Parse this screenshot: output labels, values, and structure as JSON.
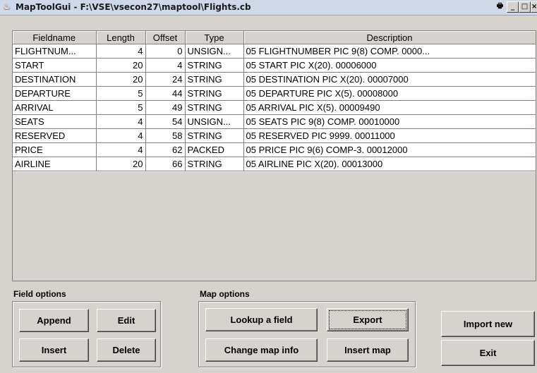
{
  "window": {
    "title": "MapToolGui - F:\\VSE\\vsecon27\\maptool\\Flights.cb",
    "buttons": {
      "print": "🖶",
      "minimize": "_",
      "maximize": "□",
      "close": "×"
    }
  },
  "table": {
    "columns": [
      "Fieldname",
      "Length",
      "Offset",
      "Type",
      "Description"
    ],
    "rows": [
      [
        "FLIGHTNUM...",
        "4",
        "0",
        "UNSIGN...",
        "05 FLIGHTNUMBER      PIC 9(8)  COMP.                0000..."
      ],
      [
        "START",
        "20",
        "4",
        "STRING",
        "05 START          PIC X(20).                00006000"
      ],
      [
        "DESTINATION",
        "20",
        "24",
        "STRING",
        "05 DESTINATION        PIC X(20).                00007000"
      ],
      [
        "DEPARTURE",
        "5",
        "44",
        "STRING",
        "05 DEPARTURE        PIC X(5).                00008000"
      ],
      [
        "ARRIVAL",
        "5",
        "49",
        "STRING",
        "05 ARRIVAL        PIC X(5).                00009490"
      ],
      [
        "SEATS",
        "4",
        "54",
        "UNSIGN...",
        "05 SEATS          PIC 9(8)  COMP.                00010000"
      ],
      [
        "RESERVED",
        "4",
        "58",
        "STRING",
        "05 RESERVED          PIC 9999.                00011000"
      ],
      [
        "PRICE",
        "4",
        "62",
        "PACKED",
        "05 PRICE        PIC 9(6)  COMP-3.                00012000"
      ],
      [
        "AIRLINE",
        "20",
        "66",
        "STRING",
        "05 AIRLINE          PIC X(20).                00013000"
      ]
    ]
  },
  "field_options": {
    "label": "Field options",
    "append": "Append",
    "edit": "Edit",
    "insert": "Insert",
    "delete": "Delete"
  },
  "map_options": {
    "label": "Map options",
    "lookup": "Lookup a field",
    "export": "Export",
    "change_map_info": "Change map info",
    "insert_map": "Insert map"
  },
  "side": {
    "import_new": "Import new",
    "exit": "Exit"
  },
  "colors": {
    "face": "#d6d3ce",
    "grid_bg": "#ffffff",
    "title_bg": "#cfd8e8"
  }
}
